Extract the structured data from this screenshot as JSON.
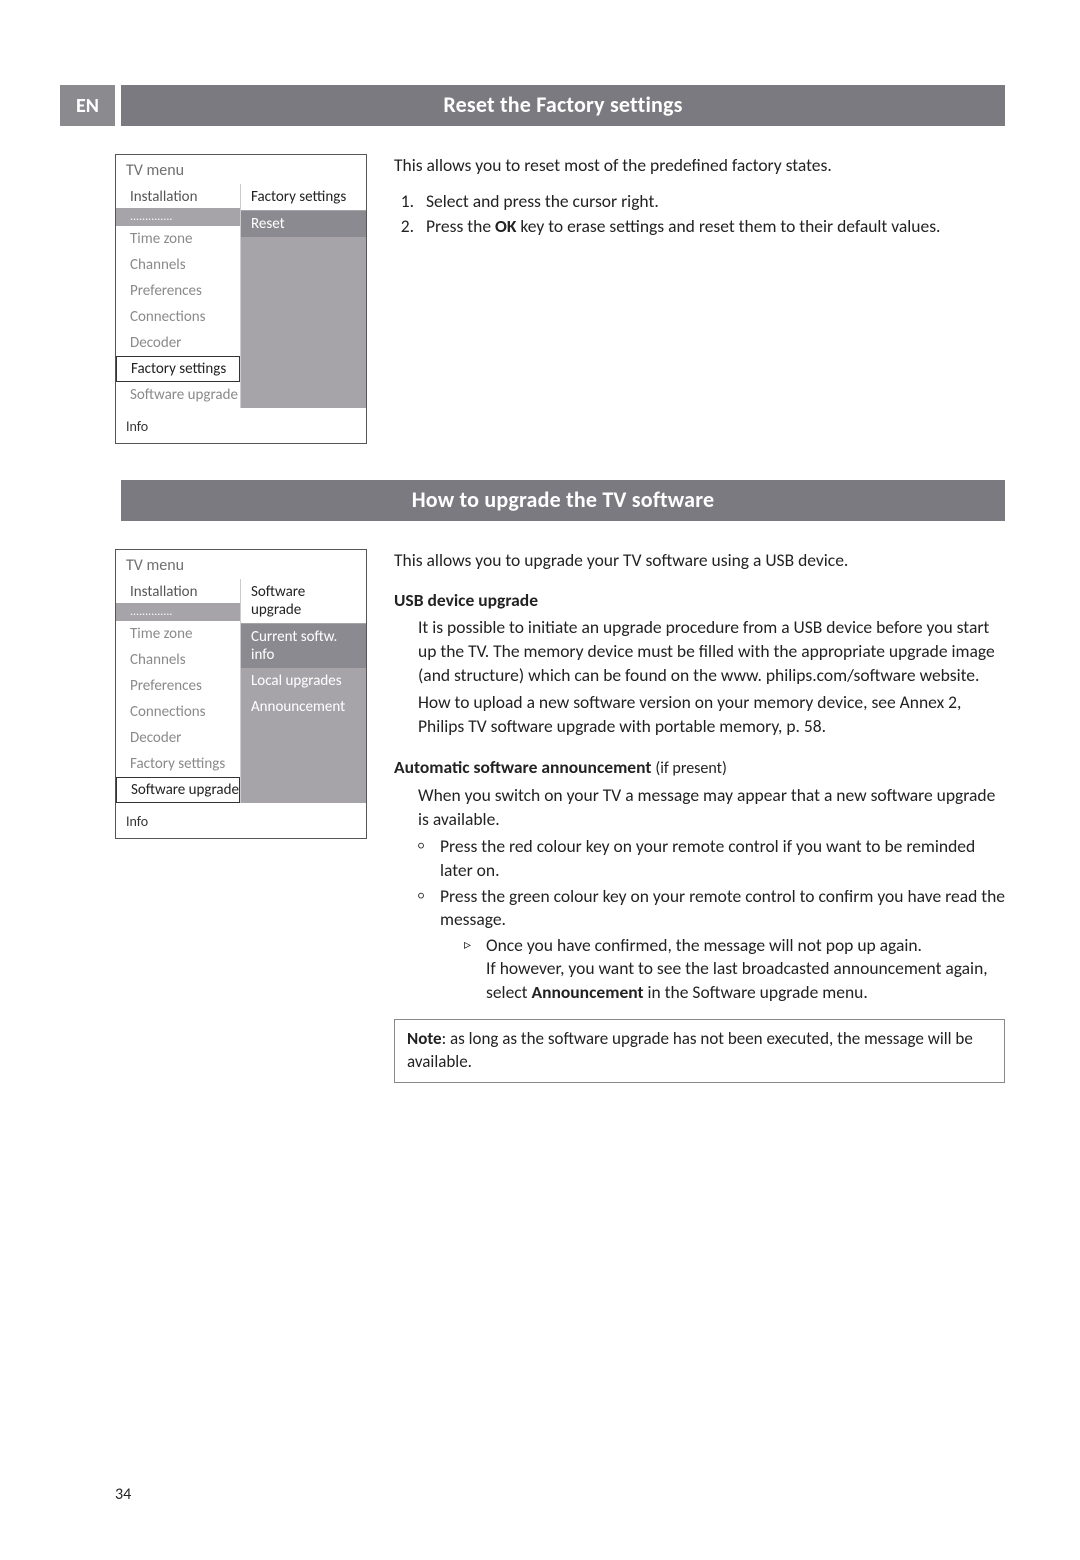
{
  "lang_tab": "EN",
  "section1": {
    "title": "Reset the Factory settings",
    "menu": {
      "title": "TV menu",
      "sub_head": "Installation",
      "right_head": "Factory settings",
      "dots": "..............",
      "left_items": [
        "Time zone",
        "Channels",
        "Preferences",
        "Connections",
        "Decoder"
      ],
      "selected": "Factory settings",
      "after_selected": "Software upgrade",
      "right_items": [
        "Reset"
      ],
      "footer": "Info"
    },
    "intro": "This allows you to reset most of the predefined factory states.",
    "steps": [
      "Select and press the cursor right.",
      "Press the OK key to erase settings and reset them to their default values."
    ],
    "ok_word": "OK"
  },
  "section2": {
    "title": "How to upgrade the TV software",
    "menu": {
      "title": "TV menu",
      "sub_head": "Installation",
      "right_head": "Software upgrade",
      "dots": "..............",
      "left_items": [
        "Time zone",
        "Channels",
        "Preferences",
        "Connections",
        "Decoder",
        "Factory settings"
      ],
      "selected": "Software upgrade",
      "right_items": [
        "Current softw. info",
        "Local upgrades",
        "Announcement"
      ],
      "footer": "Info"
    },
    "intro": "This allows you to upgrade your TV software using a USB device.",
    "usb_heading": "USB device upgrade",
    "usb_p1": "It is possible to initiate an upgrade procedure from a USB device before you start up the TV. The memory device must be filled with the appropriate upgrade image (and structure) which can be found on the www. philips.com/software website.",
    "usb_p2": "How to upload a new software version on your memory device, see Annex 2, Philips TV software upgrade with portable memory, p. 58.",
    "auto_heading": "Automatic software announcement",
    "auto_suffix": "(if present)",
    "auto_intro": "When you switch on your TV a message may appear that a new software upgrade is available.",
    "bullets": [
      "Press the red colour key on your remote control if you want to be reminded later on.",
      "Press the green colour key on your remote control to confirm you have read the message."
    ],
    "tri": "Once you have confirmed, the message will not pop up again.",
    "tri_after": "If however, you want to see the last broadcasted announcement again, select Announcement in the Software upgrade menu.",
    "announcement_word": "Announcement",
    "note_label": "Note",
    "note_text": ": as long as the software upgrade has not been executed, the message will be available."
  },
  "page_number": "34"
}
